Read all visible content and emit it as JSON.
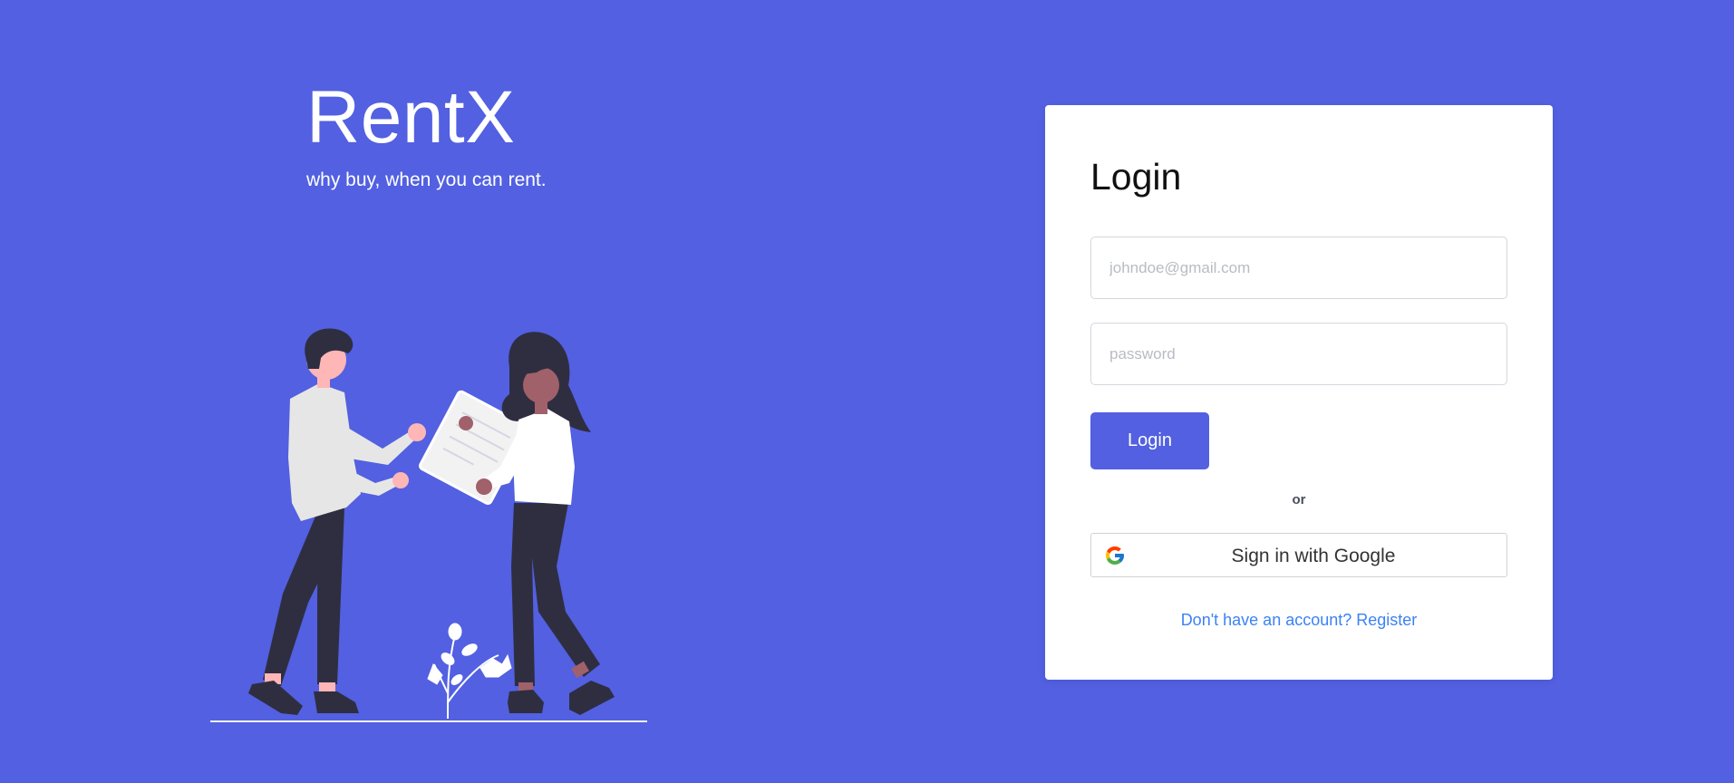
{
  "brand": {
    "title": "RentX",
    "tagline": "why buy, when you can rent."
  },
  "illustration": {
    "icon": "people-renting-illustration"
  },
  "login": {
    "title": "Login",
    "email": {
      "value": "",
      "placeholder": "johndoe@gmail.com"
    },
    "password": {
      "value": "",
      "placeholder": "password"
    },
    "submit_label": "Login",
    "divider_text": "or",
    "google_label": "Sign in with Google",
    "google_icon": "google-icon",
    "register_text": "Don't have an account? Register"
  },
  "colors": {
    "background": "#5260e1",
    "primary_button": "#5260e1",
    "link": "#3b82f6",
    "card": "#ffffff"
  }
}
